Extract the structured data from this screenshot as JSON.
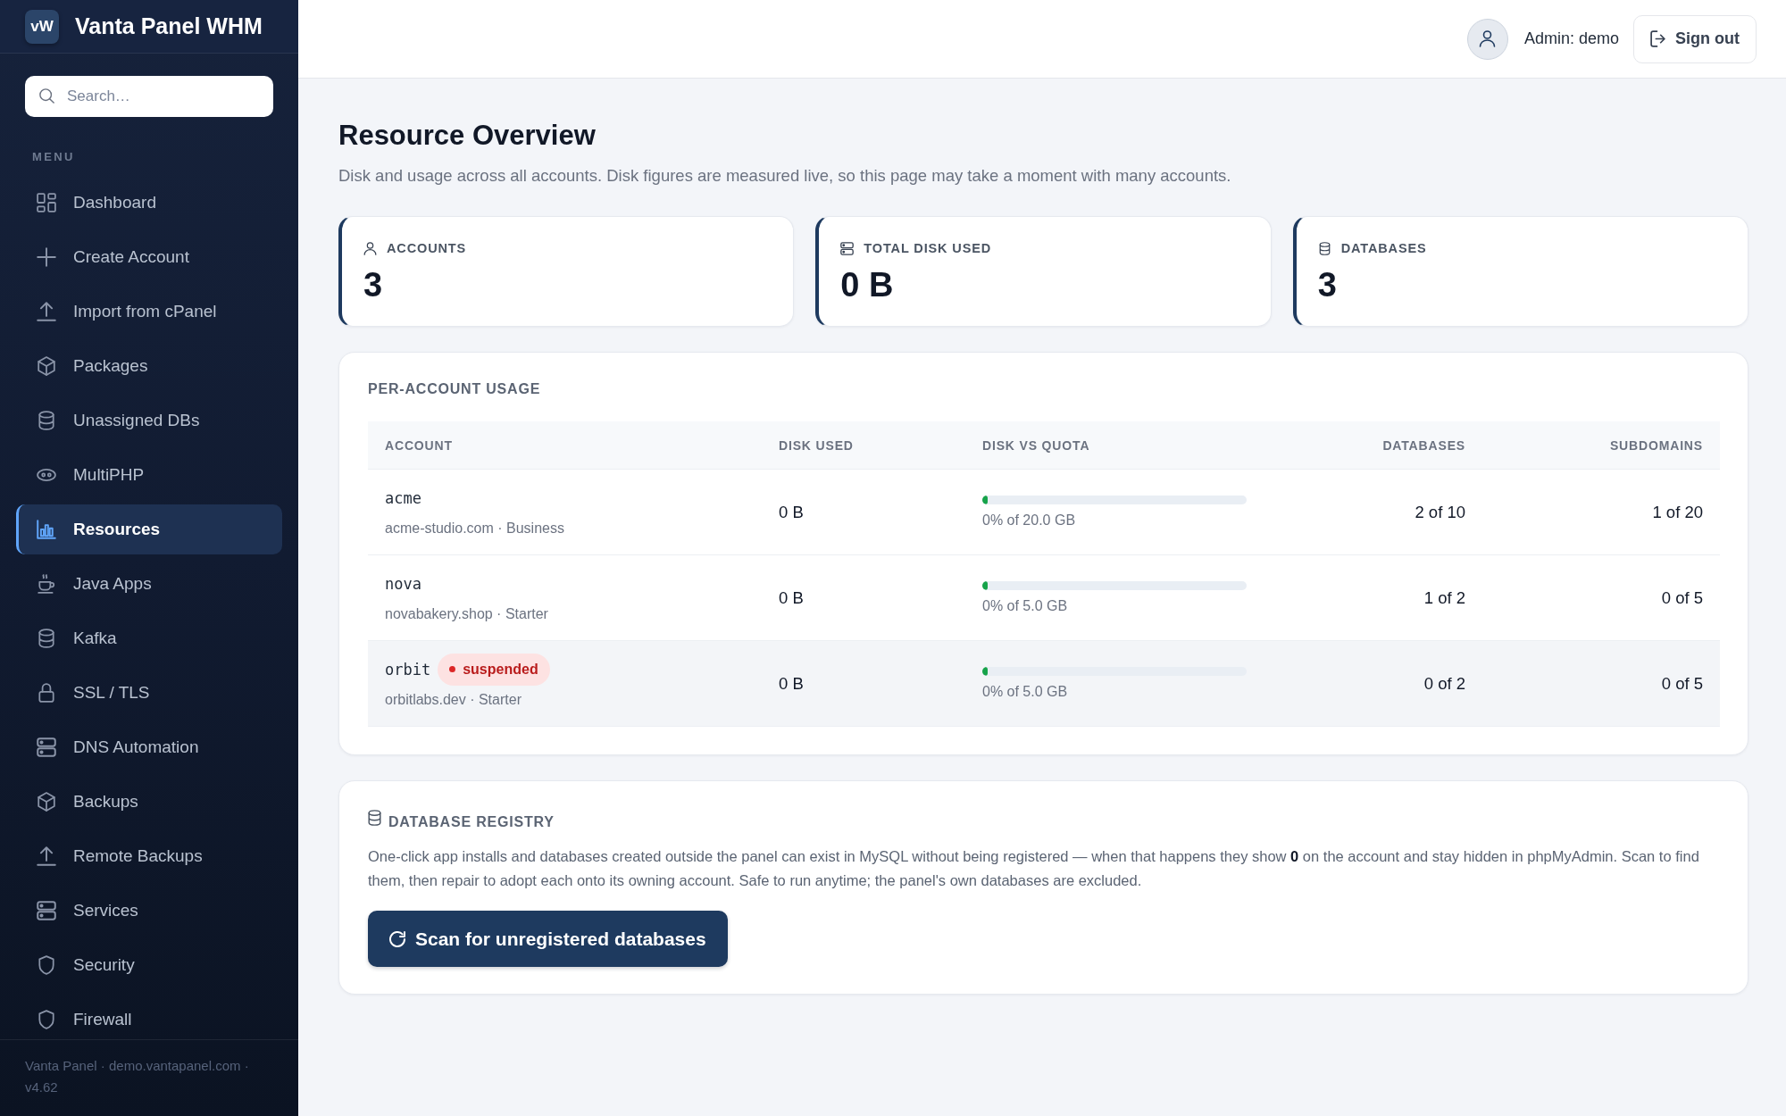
{
  "sidebar": {
    "brand": {
      "logo": "vW",
      "title": "Vanta Panel WHM"
    },
    "search": {
      "placeholder": "Search…"
    },
    "section_label": "MENU",
    "items": [
      {
        "label": "Dashboard",
        "selected": false
      },
      {
        "label": "Create Account",
        "selected": false
      },
      {
        "label": "Import from cPanel",
        "selected": false
      },
      {
        "label": "Packages",
        "selected": false
      },
      {
        "label": "Unassigned DBs",
        "selected": false
      },
      {
        "label": "MultiPHP",
        "selected": false
      },
      {
        "label": "Resources",
        "selected": true
      },
      {
        "label": "Java Apps",
        "selected": false
      },
      {
        "label": "Kafka",
        "selected": false
      },
      {
        "label": "SSL / TLS",
        "selected": false
      },
      {
        "label": "DNS Automation",
        "selected": false
      },
      {
        "label": "Backups",
        "selected": false
      },
      {
        "label": "Remote Backups",
        "selected": false
      },
      {
        "label": "Services",
        "selected": false
      },
      {
        "label": "Security",
        "selected": false
      },
      {
        "label": "Firewall",
        "selected": false
      }
    ],
    "footer": "Vanta Panel · demo.vantapanel.com · v4.62"
  },
  "topbar": {
    "user": "Admin: demo",
    "sign_out": "Sign out"
  },
  "page": {
    "title": "Resource Overview",
    "subtitle": "Disk and usage across all accounts. Disk figures are measured live, so this page may take a moment with many accounts."
  },
  "stats": [
    {
      "label": "ACCOUNTS",
      "value": "3"
    },
    {
      "label": "TOTAL DISK USED",
      "value": "0 B"
    },
    {
      "label": "DATABASES",
      "value": "3"
    }
  ],
  "usage": {
    "title": "PER-ACCOUNT USAGE",
    "columns": [
      {
        "label": "ACCOUNT"
      },
      {
        "label": "DISK USED"
      },
      {
        "label": "DISK VS QUOTA"
      },
      {
        "label": "DATABASES"
      },
      {
        "label": "SUBDOMAINS"
      }
    ],
    "rows": [
      {
        "account": "acme",
        "detail": "acme-studio.com · Business",
        "highlighted": false,
        "disk_used": "0 B",
        "level": 0.02,
        "quota": "0% of 20.0 GB",
        "databases": "2 of 10",
        "subdomains": "1 of 20"
      },
      {
        "account": "nova",
        "detail": "novabakery.shop · Starter",
        "highlighted": false,
        "disk_used": "0 B",
        "level": 0.02,
        "quota": "0% of 5.0 GB",
        "databases": "1 of 2",
        "subdomains": "0 of 5"
      },
      {
        "account": "orbit",
        "status": {
          "kind": "suspended",
          "label": "suspended"
        },
        "detail": "orbitlabs.dev · Starter",
        "highlighted": true,
        "disk_used": "0 B",
        "level": 0.02,
        "quota": "0% of 5.0 GB",
        "databases": "0 of 2",
        "subdomains": "0 of 5"
      }
    ]
  },
  "registry": {
    "title": "DATABASE REGISTRY",
    "text": "One-click app installs and databases created outside the panel can exist in MySQL without being registered — when that happens they show **0** on the account and stay hidden in phpMyAdmin. Scan to find them, then repair to adopt each onto its owning account. Safe to run anytime; the panel's own databases are excluded.",
    "button": "Scan for unregistered databases"
  }
}
